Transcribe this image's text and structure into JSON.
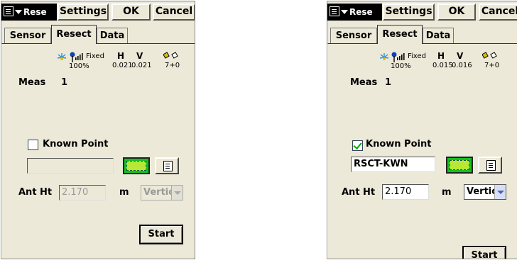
{
  "screens": [
    {
      "menu_label": "Rese",
      "settings_label": "Settings",
      "ok_label": "OK",
      "cancel_label": "Cancel",
      "tabs": [
        "Sensor",
        "Resect",
        "Data"
      ],
      "active_tab": "Resect",
      "status": {
        "battery": "100%",
        "solution": "Fixed",
        "h_label": "H",
        "h_value": "0.021",
        "v_label": "V",
        "v_value": "0.021",
        "sats": "7+0"
      },
      "meas_label": "Meas",
      "meas_value": "1",
      "known_point_label": "Known Point",
      "known_point_checked": false,
      "point_value": "",
      "ant_ht_label": "Ant Ht",
      "ant_ht_value": "2.170",
      "ant_ht_unit": "m",
      "ant_ht_mode": "Vertic",
      "start_label": "Start"
    },
    {
      "menu_label": "Rese",
      "settings_label": "Settings",
      "ok_label": "OK",
      "cancel_label": "Cancel",
      "tabs": [
        "Sensor",
        "Resect",
        "Data"
      ],
      "active_tab": "Resect",
      "status": {
        "battery": "100%",
        "solution": "Fixed",
        "h_label": "H",
        "h_value": "0.015",
        "v_label": "V",
        "v_value": "0.016",
        "sats": "7+0"
      },
      "meas_label": "Meas",
      "meas_value": "1",
      "known_point_label": "Known Point",
      "known_point_checked": true,
      "point_value": "RSCT-KWN",
      "ant_ht_label": "Ant Ht",
      "ant_ht_value": "2.170",
      "ant_ht_unit": "m",
      "ant_ht_mode": "Vertic",
      "start_label": "Start"
    }
  ],
  "colors": {
    "window_bg": "#ece9d8",
    "map_button": "#13c020",
    "check_mark": "#00aa00"
  },
  "icons": [
    "menu-icon",
    "satellite-icon",
    "antenna-icon",
    "signal-icon",
    "map-icon",
    "list-icon",
    "checkmark-icon"
  ]
}
